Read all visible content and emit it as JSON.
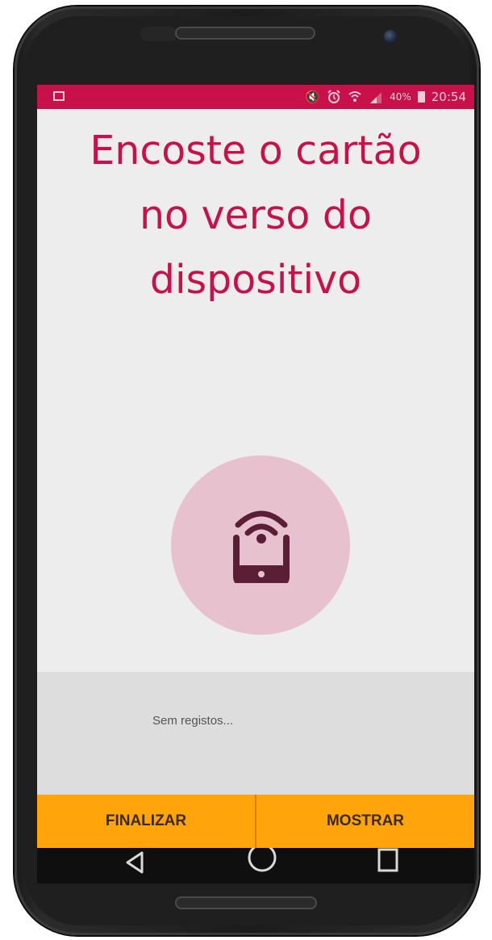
{
  "status_bar": {
    "time": "20:54",
    "battery_percent": "40%",
    "background_color": "#c8104a",
    "icons": [
      "image-notification-icon",
      "mute-icon",
      "alarm-icon",
      "wifi-icon",
      "signal-icon",
      "battery-icon"
    ]
  },
  "main": {
    "title_line1": "Encoste o cartão",
    "title_line2": "no verso do",
    "title_line3": "dispositivo",
    "title_color": "#c8104a",
    "nfc_icon": "nfc-phone-icon",
    "nfc_circle_color": "#e8c1ce"
  },
  "log": {
    "empty_text": "Sem registos..."
  },
  "actions": {
    "finalize_label": "FINALIZAR",
    "show_label": "MOSTRAR",
    "background_color": "#ffa40a"
  },
  "navigation": {
    "back_icon": "back-triangle-icon",
    "home_icon": "home-circle-icon",
    "recent_icon": "recent-square-icon"
  }
}
